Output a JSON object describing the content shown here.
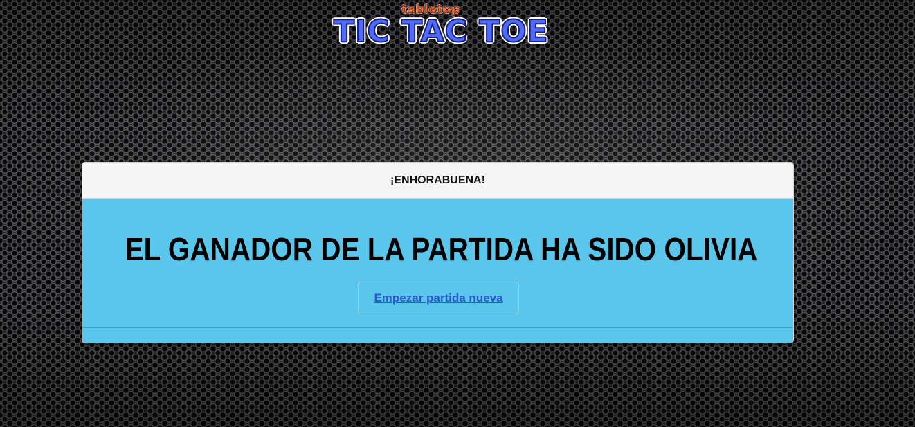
{
  "logo": {
    "subtitle": "tabletop",
    "title": "TIC TAC TOE"
  },
  "modal": {
    "title": "¡ENHORABUENA!",
    "message": "EL GANADOR DE LA PARTIDA HA SIDO OLIVIA",
    "button_label": "Empezar partida nueva"
  },
  "colors": {
    "header_bg": "#f6f5f5",
    "body_bg": "#5bc6ec",
    "link": "#2f55d4",
    "logo_blue": "#4f6bff",
    "logo_orange": "#f26a34"
  }
}
